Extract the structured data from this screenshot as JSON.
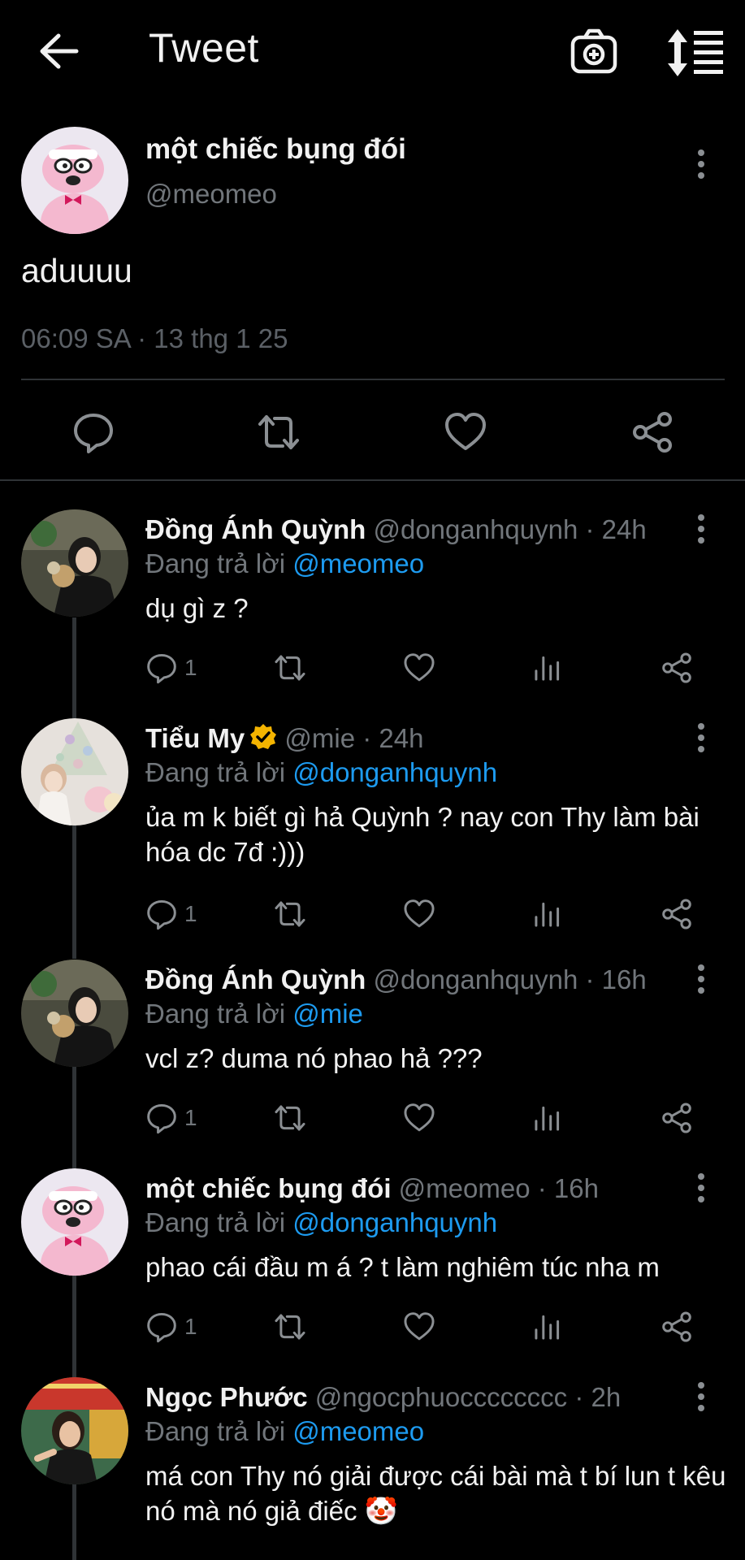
{
  "header": {
    "title": "Tweet"
  },
  "main_tweet": {
    "name": "một chiếc bụng đói",
    "handle": "@meomeo",
    "text": "aduuuu",
    "timestamp": "06:09 SA · 13 thg 1 25"
  },
  "replies": [
    {
      "name": "Đồng Ánh Quỳnh",
      "meta": " @donganhquynh · 24h",
      "replying_prefix": "Đang trả lời ",
      "replying_to": "@meomeo",
      "text": "dụ gì z ?",
      "reply_count": "1"
    },
    {
      "name": "Tiểu My",
      "meta": " @mie · 24h",
      "replying_prefix": "Đang trả lời ",
      "replying_to": "@donganhquynh",
      "text": "ủa m k biết gì hả Quỳnh ? nay con Thy làm bài hóa dc 7đ :)))",
      "reply_count": "1"
    },
    {
      "name": "Đồng Ánh Quỳnh",
      "meta": " @donganhquynh · 16h",
      "replying_prefix": "Đang trả lời ",
      "replying_to": "@mie",
      "text": "vcl z? duma nó phao hả ???",
      "reply_count": "1"
    },
    {
      "name": "một chiếc bụng đói",
      "meta": " @meomeo · 16h",
      "replying_prefix": "Đang trả lời ",
      "replying_to": "@donganhquynh",
      "text": "phao cái đầu m á ? t làm nghiêm túc nha m",
      "reply_count": "1"
    },
    {
      "name": "Ngọc Phước",
      "meta": " @ngocphuocccccccc · 2h",
      "replying_prefix": "Đang trả lời ",
      "replying_to": "@meomeo",
      "text": "má con Thy nó giải được cái bài mà t bí lun t kêu nó mà nó giả điếc 🤡",
      "reply_count": ""
    }
  ],
  "colors": {
    "background": "#000000",
    "text": "#e7e9ea",
    "secondary": "#71767b",
    "mention": "#1d9bf0",
    "verified": "#f4b400"
  }
}
